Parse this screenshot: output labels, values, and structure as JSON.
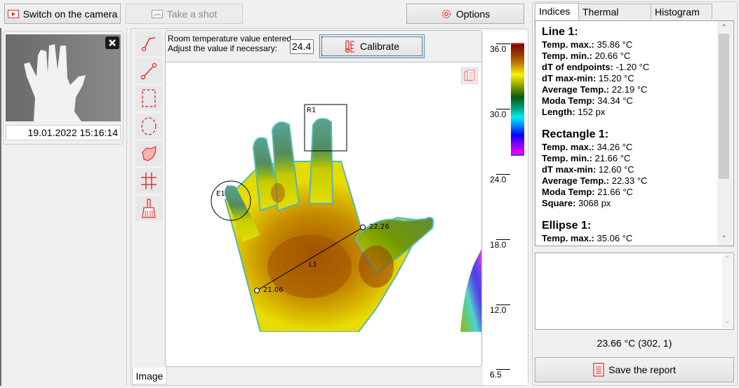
{
  "toolbar": {
    "camera_button": "Switch on the camera",
    "shot_button": "Take a shot",
    "options_button": "Options"
  },
  "thumbnail": {
    "timestamp": "19.01.2022 15:16:14"
  },
  "calibration": {
    "message_line1": "Room temperature value entered.",
    "message_line2": "Adjust the value if necessary:",
    "value": "24.4",
    "button": "Calibrate"
  },
  "tools": [
    {
      "name": "polyline-tool"
    },
    {
      "name": "line-tool"
    },
    {
      "name": "rectangle-tool"
    },
    {
      "name": "ellipse-tool"
    },
    {
      "name": "polygon-tool"
    },
    {
      "name": "grid-tool"
    },
    {
      "name": "clear-tool"
    }
  ],
  "image": {
    "tab_label": "Image",
    "annotations": {
      "rect_label": "R1",
      "ellipse_label": "E1",
      "line_label": "L1",
      "line_start_value": "21.06",
      "line_end_value": "22.26"
    }
  },
  "scale": {
    "labels": [
      "36.0",
      "30.0",
      "24.0",
      "18.0",
      "12.0",
      "6.5"
    ],
    "max": 36.0,
    "min": 6.5
  },
  "tabs": [
    "Indices",
    "Thermal profile",
    "Histogram"
  ],
  "indices": [
    {
      "title": "Line 1:",
      "rows": [
        {
          "k": "Temp. max.:",
          "v": "35.86 °C"
        },
        {
          "k": "Temp. min.:",
          "v": "20.66 °C"
        },
        {
          "k": "dT of endpoints:",
          "v": "-1.20 °C"
        },
        {
          "k": "dT max-min:",
          "v": "15.20 °C"
        },
        {
          "k": "Average Temp.:",
          "v": "22.19 °C"
        },
        {
          "k": "Moda Temp:",
          "v": "34.34 °C"
        },
        {
          "k": "Length:",
          "v": "152 px"
        }
      ]
    },
    {
      "title": "Rectangle 1:",
      "rows": [
        {
          "k": "Temp. max.:",
          "v": "34.26 °C"
        },
        {
          "k": "Temp. min.:",
          "v": "21.66 °C"
        },
        {
          "k": "dT max-min:",
          "v": "12.60 °C"
        },
        {
          "k": "Average Temp.:",
          "v": "22.33 °C"
        },
        {
          "k": "Moda Temp:",
          "v": "21.66 °C"
        },
        {
          "k": "Square:",
          "v": "3068 px"
        }
      ]
    },
    {
      "title": "Ellipse 1:",
      "rows": [
        {
          "k": "Temp. max.:",
          "v": "35.06 °C"
        }
      ]
    }
  ],
  "notes": {
    "value": ""
  },
  "cursor_readout": "23.66 °C (302, 1)",
  "save_button": "Save the report",
  "colors": {
    "accent_icon": "#e03030",
    "focus_border": "#3c8fd8"
  }
}
